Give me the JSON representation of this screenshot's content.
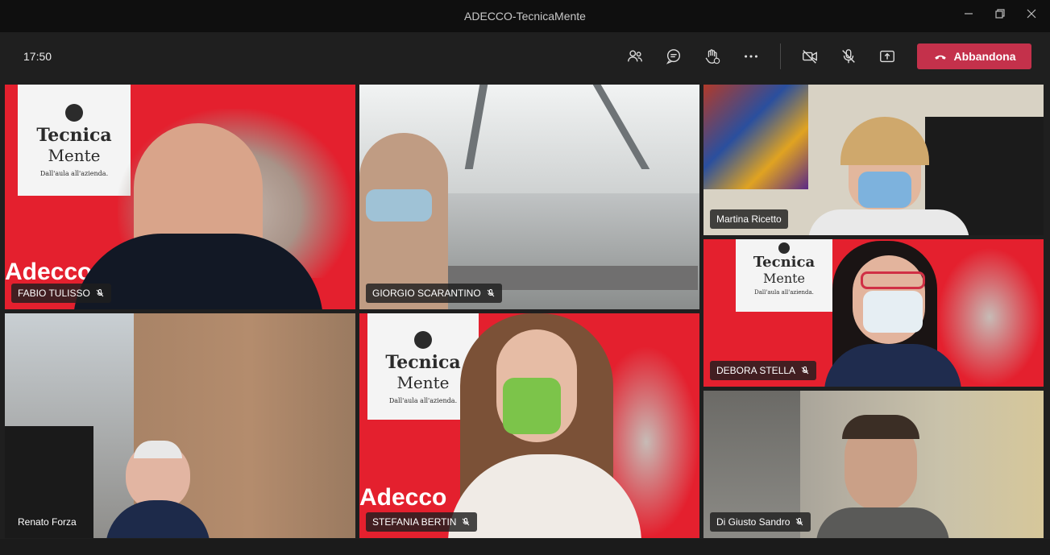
{
  "window": {
    "title": "ADECCO-TecnicaMente"
  },
  "toolbar": {
    "time": "17:50",
    "leave_label": "Abbandona"
  },
  "brand": {
    "logo_line1": "Tecnica",
    "logo_line2": "Mente",
    "logo_tagline": "Dall'aula all'azienda.",
    "adecco": "Adecco"
  },
  "participants": [
    {
      "name": "FABIO TULISSO",
      "muted": true
    },
    {
      "name": "GIORGIO SCARANTINO",
      "muted": true
    },
    {
      "name": "Martina Ricetto",
      "muted": false
    },
    {
      "name": "DEBORA STELLA",
      "muted": true
    },
    {
      "name": "Renato Forza",
      "muted": false
    },
    {
      "name": "STEFANIA BERTIN",
      "muted": true
    },
    {
      "name": "Di Giusto Sandro",
      "muted": true
    }
  ],
  "colors": {
    "accent_leave": "#c4314b",
    "brand_red": "#e4202e"
  }
}
